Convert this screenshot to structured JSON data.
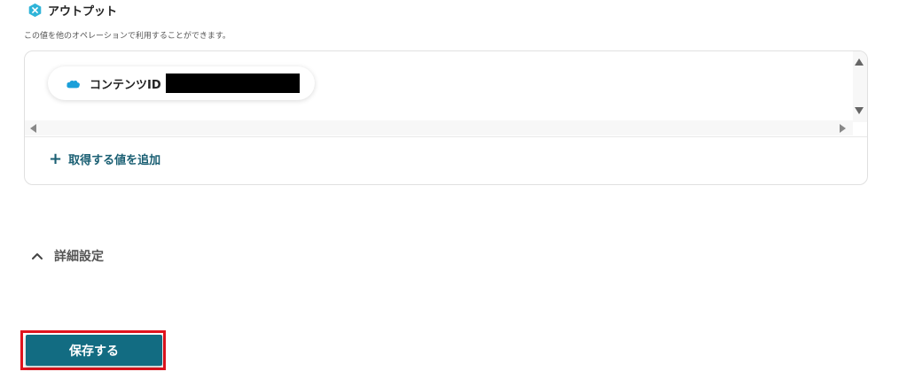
{
  "output_section": {
    "icon": "x-badge-icon",
    "title": "アウトプット",
    "description": "この値を他のオペレーションで利用することができます。"
  },
  "output_box": {
    "chip": {
      "icon": "salesforce-cloud-icon",
      "label": "コンテンツID",
      "value_redacted": true
    },
    "add_value_label": "取得する値を追加"
  },
  "advanced_settings": {
    "label": "詳細設定",
    "expanded": true
  },
  "save_button": {
    "label": "保存する"
  },
  "colors": {
    "accent": "#126c82",
    "link": "#1a5f73",
    "highlight": "#e0141e",
    "badge": "#2fb4d8"
  }
}
